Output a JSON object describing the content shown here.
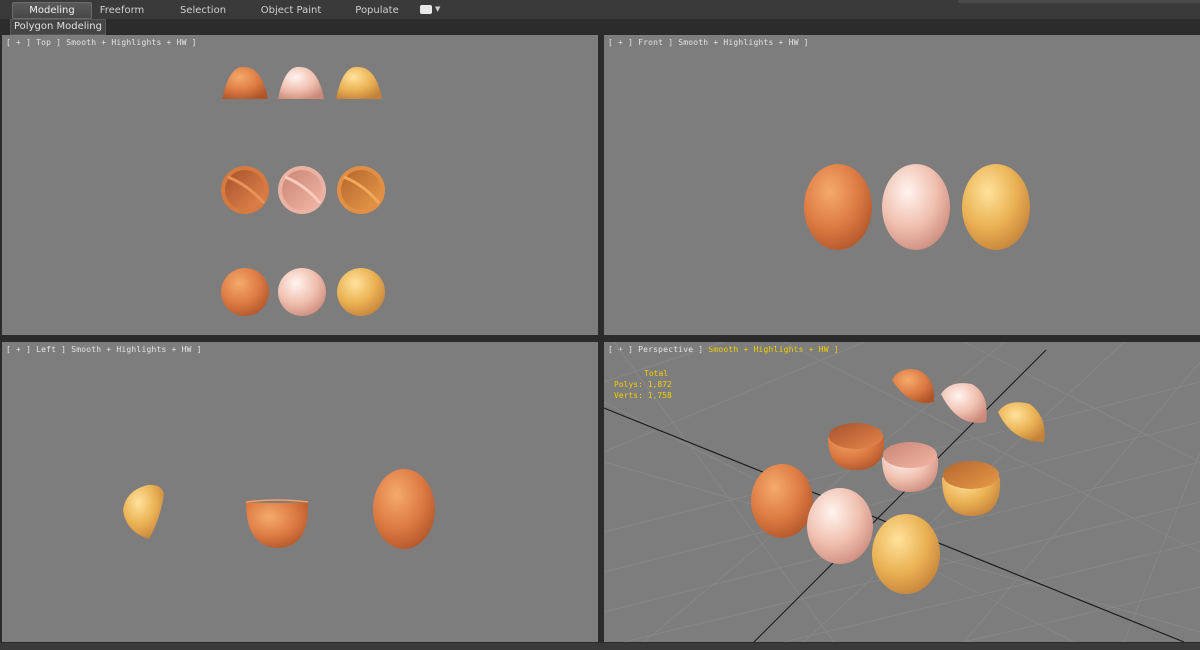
{
  "ribbon": {
    "tabs": [
      {
        "label": "Modeling"
      },
      {
        "label": "Freeform"
      },
      {
        "label": "Selection"
      },
      {
        "label": "Object Paint"
      },
      {
        "label": "Populate"
      }
    ]
  },
  "panel": {
    "label": "Polygon Modeling"
  },
  "viewports": {
    "top": {
      "label": "[ + ] Top ] Smooth + Highlights + HW ]"
    },
    "front": {
      "label": "[ + ] Front ] Smooth + Highlights + HW ]"
    },
    "left": {
      "label": "[ + ] Left ] Smooth + Highlights + HW ]"
    },
    "persp": {
      "label_name": "[ + ] Perspective ]",
      "label_shading": "Smooth + Highlights + HW ]",
      "stats": {
        "title": "Total",
        "polys": "Polys: 1,872",
        "verts": "Verts: 1,758"
      }
    }
  },
  "colors": {
    "viewport_bg": "#7d7d7d",
    "egg_brown": "#d9783f",
    "egg_pink": "#f0c0b0",
    "egg_gold": "#eab254",
    "highlight_text": "#f2d000"
  }
}
